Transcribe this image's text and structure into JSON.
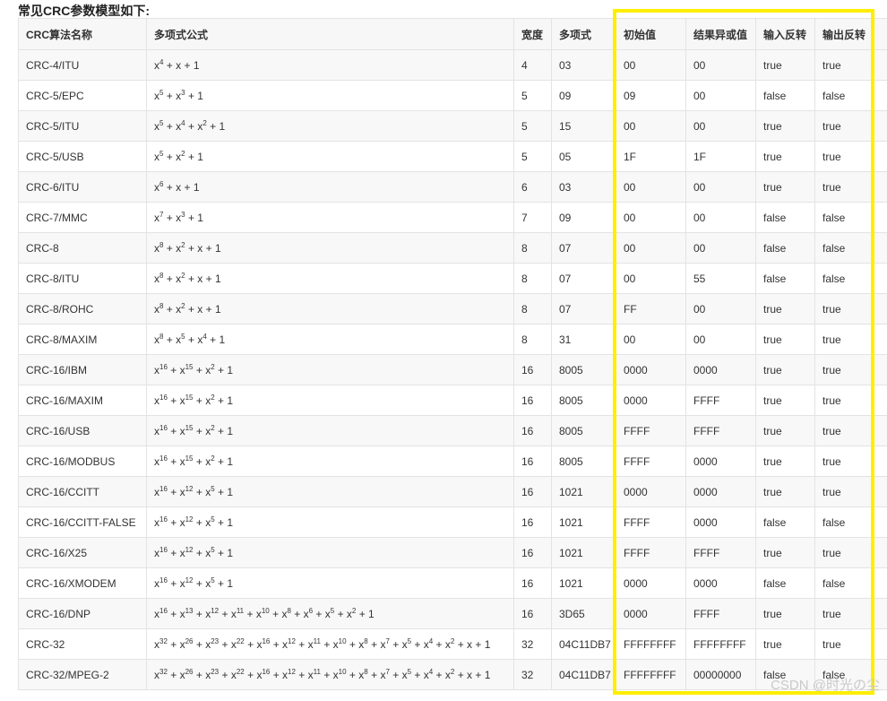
{
  "heading": "常见CRC参数模型如下:",
  "headers": [
    "CRC算法名称",
    "多项式公式",
    "宽度",
    "多项式",
    "初始值",
    "结果异或值",
    "输入反转",
    "输出反转"
  ],
  "rows": [
    {
      "name": "CRC-4/ITU",
      "poly": [
        [
          "x",
          "4"
        ],
        "+ x + 1"
      ],
      "width": "4",
      "hex": "03",
      "init": "00",
      "xorout": "00",
      "refin": "true",
      "refout": "true"
    },
    {
      "name": "CRC-5/EPC",
      "poly": [
        [
          "x",
          "5"
        ],
        "+",
        [
          "x",
          "3"
        ],
        "+ 1"
      ],
      "width": "5",
      "hex": "09",
      "init": "09",
      "xorout": "00",
      "refin": "false",
      "refout": "false"
    },
    {
      "name": "CRC-5/ITU",
      "poly": [
        [
          "x",
          "5"
        ],
        "+",
        [
          "x",
          "4"
        ],
        "+",
        [
          "x",
          "2"
        ],
        "+ 1"
      ],
      "width": "5",
      "hex": "15",
      "init": "00",
      "xorout": "00",
      "refin": "true",
      "refout": "true"
    },
    {
      "name": "CRC-5/USB",
      "poly": [
        [
          "x",
          "5"
        ],
        "+",
        [
          "x",
          "2"
        ],
        "+ 1"
      ],
      "width": "5",
      "hex": "05",
      "init": "1F",
      "xorout": "1F",
      "refin": "true",
      "refout": "true"
    },
    {
      "name": "CRC-6/ITU",
      "poly": [
        [
          "x",
          "6"
        ],
        "+ x + 1"
      ],
      "width": "6",
      "hex": "03",
      "init": "00",
      "xorout": "00",
      "refin": "true",
      "refout": "true"
    },
    {
      "name": "CRC-7/MMC",
      "poly": [
        [
          "x",
          "7"
        ],
        "+",
        [
          "x",
          "3"
        ],
        "+ 1"
      ],
      "width": "7",
      "hex": "09",
      "init": "00",
      "xorout": "00",
      "refin": "false",
      "refout": "false"
    },
    {
      "name": "CRC-8",
      "poly": [
        [
          "x",
          "8"
        ],
        "+",
        [
          "x",
          "2"
        ],
        "+ x + 1"
      ],
      "width": "8",
      "hex": "07",
      "init": "00",
      "xorout": "00",
      "refin": "false",
      "refout": "false"
    },
    {
      "name": "CRC-8/ITU",
      "poly": [
        [
          "x",
          "8"
        ],
        "+",
        [
          "x",
          "2"
        ],
        "+ x + 1"
      ],
      "width": "8",
      "hex": "07",
      "init": "00",
      "xorout": "55",
      "refin": "false",
      "refout": "false"
    },
    {
      "name": "CRC-8/ROHC",
      "poly": [
        [
          "x",
          "8"
        ],
        "+",
        [
          "x",
          "2"
        ],
        "+ x + 1"
      ],
      "width": "8",
      "hex": "07",
      "init": "FF",
      "xorout": "00",
      "refin": "true",
      "refout": "true"
    },
    {
      "name": "CRC-8/MAXIM",
      "poly": [
        [
          "x",
          "8"
        ],
        "+",
        [
          "x",
          "5"
        ],
        "+",
        [
          "x",
          "4"
        ],
        "+ 1"
      ],
      "width": "8",
      "hex": "31",
      "init": "00",
      "xorout": "00",
      "refin": "true",
      "refout": "true"
    },
    {
      "name": "CRC-16/IBM",
      "poly": [
        [
          "x",
          "16"
        ],
        "+",
        [
          "x",
          "15"
        ],
        "+",
        [
          "x",
          "2"
        ],
        "+ 1"
      ],
      "width": "16",
      "hex": "8005",
      "init": "0000",
      "xorout": "0000",
      "refin": "true",
      "refout": "true"
    },
    {
      "name": "CRC-16/MAXIM",
      "poly": [
        [
          "x",
          "16"
        ],
        "+",
        [
          "x",
          "15"
        ],
        "+",
        [
          "x",
          "2"
        ],
        "+ 1"
      ],
      "width": "16",
      "hex": "8005",
      "init": "0000",
      "xorout": "FFFF",
      "refin": "true",
      "refout": "true"
    },
    {
      "name": "CRC-16/USB",
      "poly": [
        [
          "x",
          "16"
        ],
        "+",
        [
          "x",
          "15"
        ],
        "+",
        [
          "x",
          "2"
        ],
        "+ 1"
      ],
      "width": "16",
      "hex": "8005",
      "init": "FFFF",
      "xorout": "FFFF",
      "refin": "true",
      "refout": "true"
    },
    {
      "name": "CRC-16/MODBUS",
      "poly": [
        [
          "x",
          "16"
        ],
        "+",
        [
          "x",
          "15"
        ],
        "+",
        [
          "x",
          "2"
        ],
        "+ 1"
      ],
      "width": "16",
      "hex": "8005",
      "init": "FFFF",
      "xorout": "0000",
      "refin": "true",
      "refout": "true"
    },
    {
      "name": "CRC-16/CCITT",
      "poly": [
        [
          "x",
          "16"
        ],
        "+",
        [
          "x",
          "12"
        ],
        "+",
        [
          "x",
          "5"
        ],
        "+ 1"
      ],
      "width": "16",
      "hex": "1021",
      "init": "0000",
      "xorout": "0000",
      "refin": "true",
      "refout": "true"
    },
    {
      "name": "CRC-16/CCITT-FALSE",
      "poly": [
        [
          "x",
          "16"
        ],
        "+",
        [
          "x",
          "12"
        ],
        "+",
        [
          "x",
          "5"
        ],
        "+ 1"
      ],
      "width": "16",
      "hex": "1021",
      "init": "FFFF",
      "xorout": "0000",
      "refin": "false",
      "refout": "false"
    },
    {
      "name": "CRC-16/X25",
      "poly": [
        [
          "x",
          "16"
        ],
        "+",
        [
          "x",
          "12"
        ],
        "+",
        [
          "x",
          "5"
        ],
        "+ 1"
      ],
      "width": "16",
      "hex": "1021",
      "init": "FFFF",
      "xorout": "FFFF",
      "refin": "true",
      "refout": "true"
    },
    {
      "name": "CRC-16/XMODEM",
      "poly": [
        [
          "x",
          "16"
        ],
        "+",
        [
          "x",
          "12"
        ],
        "+",
        [
          "x",
          "5"
        ],
        "+ 1"
      ],
      "width": "16",
      "hex": "1021",
      "init": "0000",
      "xorout": "0000",
      "refin": "false",
      "refout": "false"
    },
    {
      "name": "CRC-16/DNP",
      "poly": [
        [
          "x",
          "16"
        ],
        "+",
        [
          "x",
          "13"
        ],
        "+",
        [
          "x",
          "12"
        ],
        "+",
        [
          "x",
          "11"
        ],
        "+",
        [
          "x",
          "10"
        ],
        "+",
        [
          "x",
          "8"
        ],
        "+",
        [
          "x",
          "6"
        ],
        "+",
        [
          "x",
          "5"
        ],
        "+",
        [
          "x",
          "2"
        ],
        "+ 1"
      ],
      "width": "16",
      "hex": "3D65",
      "init": "0000",
      "xorout": "FFFF",
      "refin": "true",
      "refout": "true"
    },
    {
      "name": "CRC-32",
      "poly": [
        [
          "x",
          "32"
        ],
        "+",
        [
          "x",
          "26"
        ],
        "+",
        [
          "x",
          "23"
        ],
        "+",
        [
          "x",
          "22"
        ],
        "+",
        [
          "x",
          "16"
        ],
        "+",
        [
          "x",
          "12"
        ],
        "+",
        [
          "x",
          "11"
        ],
        "+",
        [
          "x",
          "10"
        ],
        "+",
        [
          "x",
          "8"
        ],
        "+",
        [
          "x",
          "7"
        ],
        "+",
        [
          "x",
          "5"
        ],
        "+",
        [
          "x",
          "4"
        ],
        "+",
        [
          "x",
          "2"
        ],
        "+ x + 1"
      ],
      "width": "32",
      "hex": "04C11DB7",
      "init": "FFFFFFFF",
      "xorout": "FFFFFFFF",
      "refin": "true",
      "refout": "true"
    },
    {
      "name": "CRC-32/MPEG-2",
      "poly": [
        [
          "x",
          "32"
        ],
        "+",
        [
          "x",
          "26"
        ],
        "+",
        [
          "x",
          "23"
        ],
        "+",
        [
          "x",
          "22"
        ],
        "+",
        [
          "x",
          "16"
        ],
        "+",
        [
          "x",
          "12"
        ],
        "+",
        [
          "x",
          "11"
        ],
        "+",
        [
          "x",
          "10"
        ],
        "+",
        [
          "x",
          "8"
        ],
        "+",
        [
          "x",
          "7"
        ],
        "+",
        [
          "x",
          "5"
        ],
        "+",
        [
          "x",
          "4"
        ],
        "+",
        [
          "x",
          "2"
        ],
        "+ x + 1"
      ],
      "width": "32",
      "hex": "04C11DB7",
      "init": "FFFFFFFF",
      "xorout": "00000000",
      "refin": "false",
      "refout": "false"
    }
  ],
  "highlight_color": "#ffee00",
  "watermark": "CSDN @时光の尘"
}
